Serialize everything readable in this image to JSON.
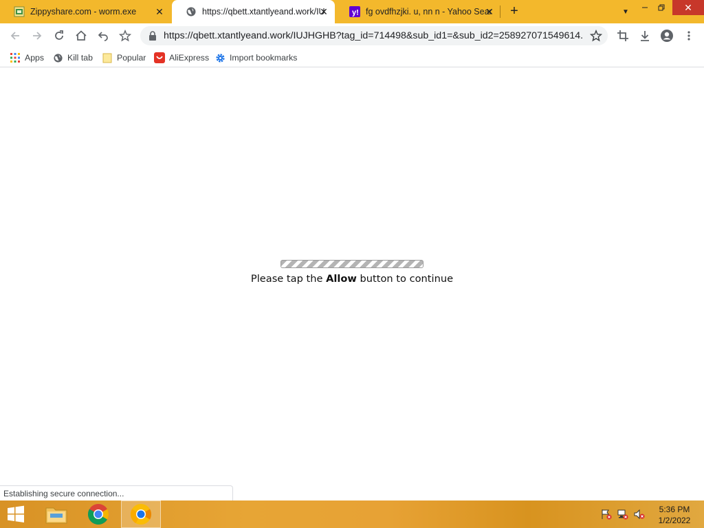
{
  "browser": {
    "tabs": [
      {
        "title": "Zippyshare.com - worm.exe",
        "active": false,
        "favicon": "zippyshare-favicon"
      },
      {
        "title": "https://qbett.xtantlyeand.work/IU",
        "active": true,
        "favicon": "globe-icon"
      },
      {
        "title": "fg ovdfhzjki. u, nn n - Yahoo Sear",
        "active": false,
        "favicon": "yahoo-favicon"
      }
    ],
    "close_glyph": "✕",
    "new_tab_glyph": "+",
    "window_controls": {
      "minimize": "—",
      "restore": "❐",
      "close": "✕"
    },
    "url": "https://qbett.xtantlyeand.work/IUJHGHB?tag_id=714498&sub_id1=&sub_id2=258927071549614..."
  },
  "bookmarks": [
    {
      "label": "Apps",
      "icon": "apps-grid-icon"
    },
    {
      "label": "Kill tab",
      "icon": "kill-tab-icon"
    },
    {
      "label": "Popular",
      "icon": "folder-icon"
    },
    {
      "label": "AliExpress",
      "icon": "aliexpress-icon"
    },
    {
      "label": "Import bookmarks",
      "icon": "gear-icon"
    }
  ],
  "page": {
    "message_before": "Please tap the ",
    "message_bold": "Allow",
    "message_after": " button to continue",
    "progress_fraction": 1.0
  },
  "status_bar": {
    "text": "Establishing secure connection..."
  },
  "taskbar": {
    "items": [
      {
        "name": "start-button",
        "icon": "windows-logo-icon"
      },
      {
        "name": "file-explorer",
        "icon": "folder-icon"
      },
      {
        "name": "chrome",
        "icon": "chrome-icon"
      },
      {
        "name": "chrome-canary-active",
        "icon": "chrome-icon",
        "active": true
      }
    ],
    "clock": {
      "time": "5:36 PM",
      "date": "1/2/2022"
    }
  },
  "colors": {
    "tabstrip": "#f3b82c",
    "taskbar": "#e7a535",
    "close_button": "#c7372a"
  }
}
